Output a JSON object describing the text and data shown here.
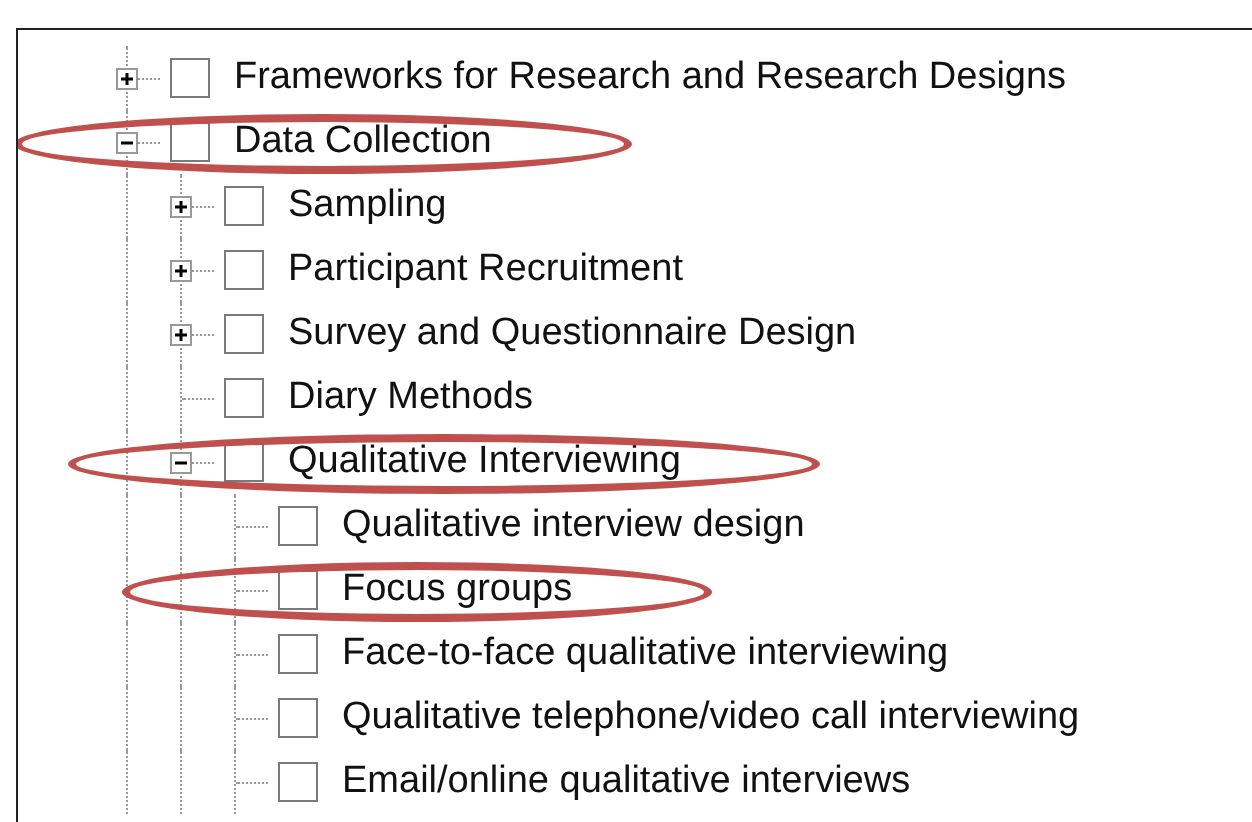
{
  "tree": [
    {
      "label": "Frameworks for Research and Research Designs",
      "kind": "branch",
      "expanded": false,
      "checked": false,
      "circled": false
    },
    {
      "label": "Data Collection",
      "kind": "branch",
      "expanded": true,
      "checked": false,
      "circled": true,
      "children": [
        {
          "label": "Sampling",
          "kind": "branch",
          "expanded": false,
          "checked": false,
          "circled": false
        },
        {
          "label": "Participant Recruitment",
          "kind": "branch",
          "expanded": false,
          "checked": false,
          "circled": false
        },
        {
          "label": "Survey and Questionnaire Design",
          "kind": "branch",
          "expanded": false,
          "checked": false,
          "circled": false
        },
        {
          "label": "Diary Methods",
          "kind": "leaf",
          "checked": false,
          "circled": false
        },
        {
          "label": "Qualitative Interviewing",
          "kind": "branch",
          "expanded": true,
          "checked": false,
          "circled": true,
          "children": [
            {
              "label": "Qualitative interview design",
              "kind": "leaf",
              "checked": false,
              "circled": false
            },
            {
              "label": "Focus groups",
              "kind": "leaf",
              "checked": false,
              "circled": true
            },
            {
              "label": "Face-to-face qualitative interviewing",
              "kind": "leaf",
              "checked": false,
              "circled": false
            },
            {
              "label": "Qualitative telephone/video call interviewing",
              "kind": "leaf",
              "checked": false,
              "circled": false
            },
            {
              "label": "Email/online qualitative interviews",
              "kind": "leaf",
              "checked": false,
              "circled": false
            }
          ]
        }
      ]
    }
  ]
}
